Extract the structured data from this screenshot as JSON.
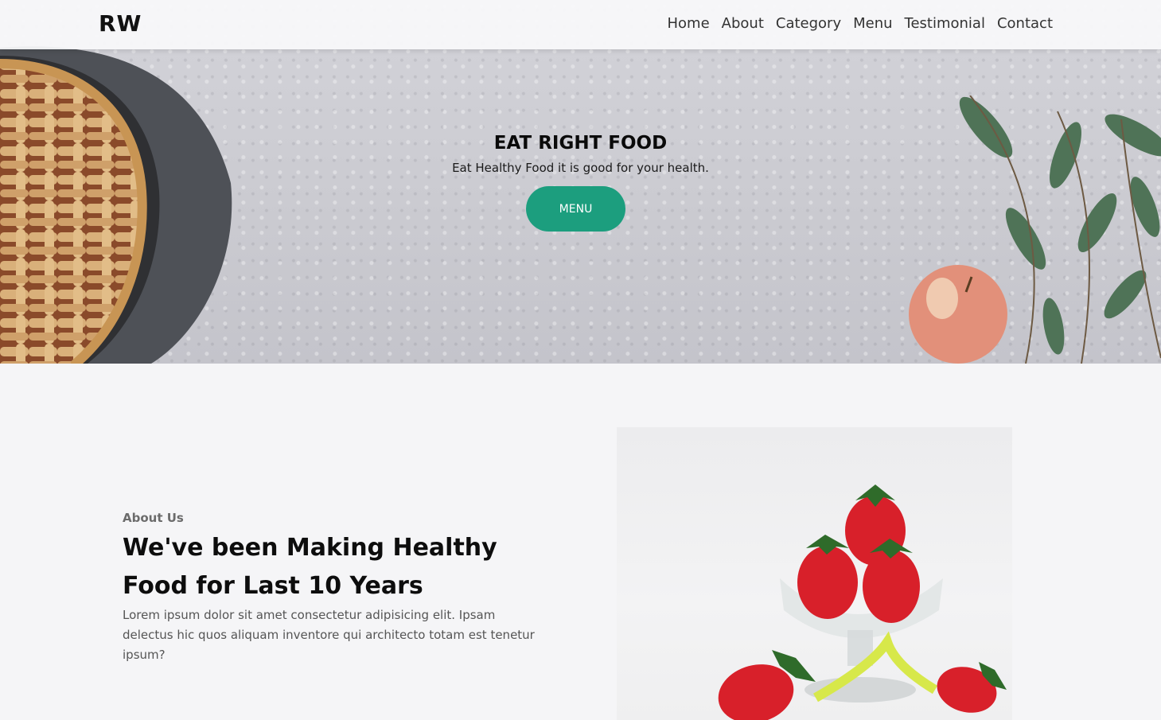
{
  "navbar": {
    "logo": "RW",
    "links": [
      "Home",
      "About",
      "Category",
      "Menu",
      "Testimonial",
      "Contact"
    ]
  },
  "hero": {
    "title": "EAT RIGHT FOOD",
    "subtitle": "Eat Healthy Food it is good for your health.",
    "button_label": "MENU"
  },
  "about": {
    "kicker": "About Us",
    "heading": "We've been Making Healthy Food for Last 10 Years",
    "text": "Lorem ipsum dolor sit amet consectetur adipisicing elit. Ipsam delectus hic quos aliquam inventore qui architecto totam est tenetur ipsum?"
  },
  "colors": {
    "accent": "#1c9e7e",
    "page_background": "#f5f5f7",
    "heading": "#0d0d0d",
    "body_text": "#555555"
  }
}
